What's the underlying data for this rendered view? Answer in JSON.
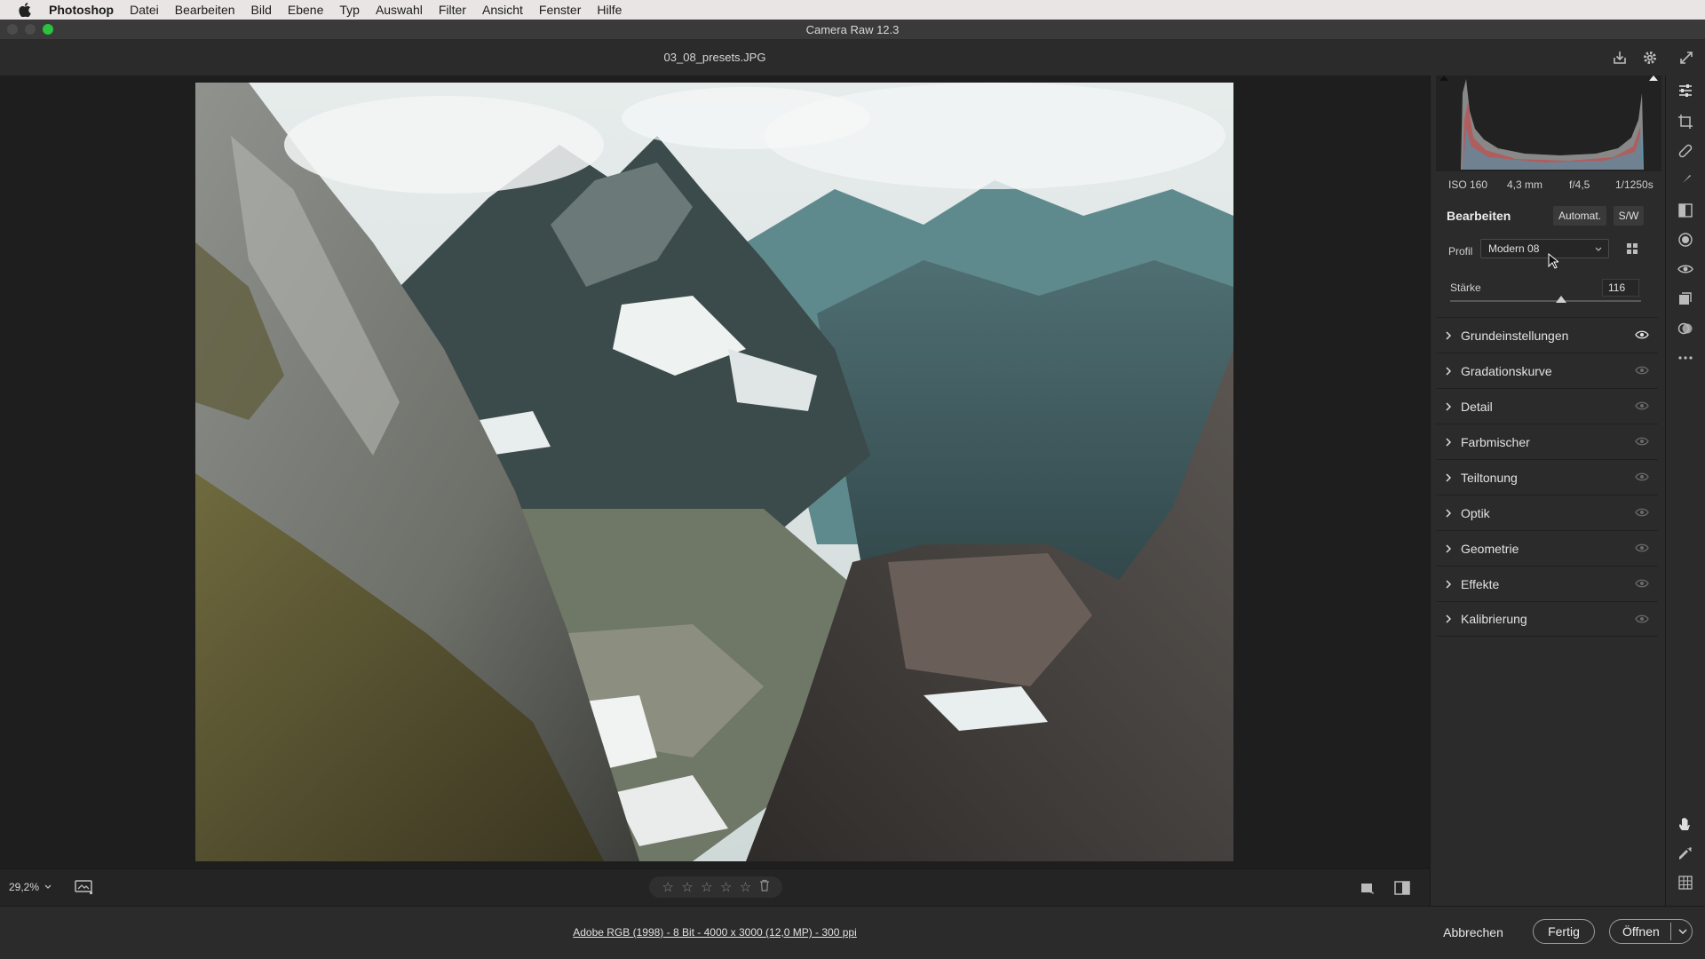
{
  "menubar": {
    "items": [
      "Photoshop",
      "Datei",
      "Bearbeiten",
      "Bild",
      "Ebene",
      "Typ",
      "Auswahl",
      "Filter",
      "Ansicht",
      "Fenster",
      "Hilfe"
    ]
  },
  "window": {
    "title": "Camera Raw 12.3"
  },
  "document": {
    "filename": "03_08_presets.JPG"
  },
  "viewbar": {
    "zoom": "29,2%",
    "stars": 5
  },
  "footer": {
    "image_info": "Adobe RGB (1998) - 8 Bit - 4000 x 3000 (12,0 MP) - 300 ppi",
    "cancel": "Abbrechen",
    "done": "Fertig",
    "open": "Öffnen"
  },
  "panel": {
    "exif": {
      "iso": "ISO 160",
      "focal": "4,3 mm",
      "aperture": "f/4,5",
      "shutter": "1/1250s"
    },
    "edit_title": "Bearbeiten",
    "auto_label": "Automat.",
    "bw_label": "S/W",
    "profile_label": "Profil",
    "profile_value": "Modern 08",
    "amount_label": "Stärke",
    "amount_value": "116",
    "amount_fraction": 0.58,
    "sections": [
      "Grundeinstellungen",
      "Gradationskurve",
      "Detail",
      "Farbmischer",
      "Teiltonung",
      "Optik",
      "Geometrie",
      "Effekte",
      "Kalibrierung"
    ]
  },
  "colors": {
    "accent_green": "#29c33f",
    "panel_bg": "#2b2b2b",
    "canvas_bg": "#1e1e1e"
  }
}
